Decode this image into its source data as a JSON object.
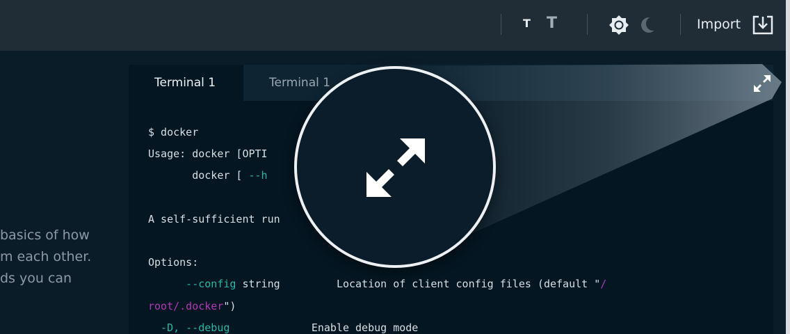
{
  "header": {
    "font_size_small_label": "T",
    "font_size_large_label": "T",
    "light_theme_icon": "sun-icon",
    "dark_theme_icon": "moon-icon",
    "import_label": "Import",
    "import_icon": "import-download-icon"
  },
  "intro": {
    "lines": [
      "basics of how",
      "m each other.",
      "ds you can"
    ]
  },
  "terminal": {
    "tabs": [
      {
        "label": "Terminal 1",
        "active": true
      },
      {
        "label": "Terminal 1",
        "active": false
      }
    ],
    "fullscreen_icon": "expand-icon",
    "lines": {
      "cmd": "$ docker",
      "usage1": "Usage: docker [OPTI",
      "usage2_prefix": "       docker [ ",
      "usage2_flag": "--h",
      "desc": "A self-sufficient run",
      "options_header": "Options:",
      "opt1_flag": "      --config",
      "opt1_type": " string       ",
      "opt1_desc": "Location of client config files (default \"",
      "opt1_default_start": "/",
      "opt1_default_end": "root/.docker",
      "opt1_close": "\")",
      "opt2_flag": "  -D, --debug",
      "opt2_desc": "Enable debug mode"
    }
  },
  "callout": {
    "icon": "expand-icon"
  },
  "colors": {
    "background": "#0b1c29",
    "header": "#202d37",
    "terminal": "#041621",
    "flag_teal": "#22b8a8",
    "string_purple": "#b13ab6"
  }
}
